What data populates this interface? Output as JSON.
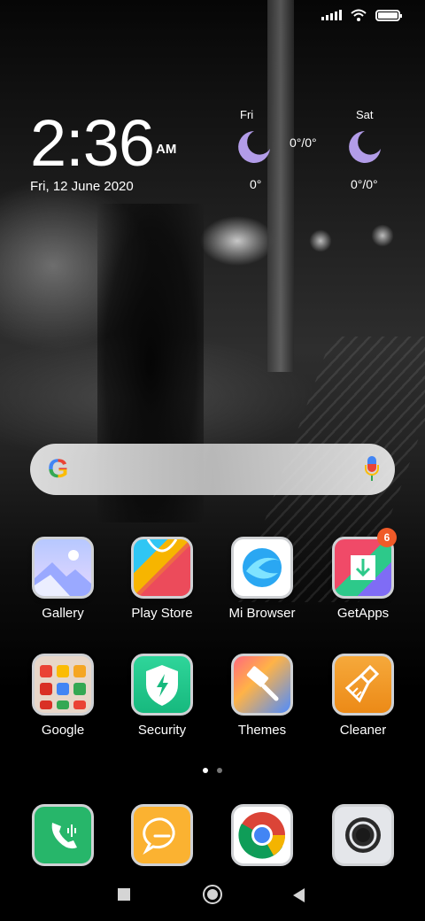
{
  "status_bar": {
    "signal_icon": "signal-icon",
    "wifi_icon": "wifi-icon",
    "battery_icon": "battery-icon",
    "battery_level": 1.0
  },
  "clock": {
    "time": "2:36",
    "ampm": "AM",
    "date": "Fri, 12 June 2020"
  },
  "weather": {
    "days": [
      {
        "day": "Fri",
        "icon": "moon-icon",
        "temp_low": "0°",
        "temp_range": "0°/0°"
      },
      {
        "day": "Sat",
        "icon": "moon-icon",
        "temp_range": "0°/0°"
      }
    ],
    "moon_color": "#b29ce8"
  },
  "search": {
    "logo": "G",
    "mic_icon": "mic-icon"
  },
  "apps": [
    {
      "label": "Gallery",
      "icon": "gallery-icon"
    },
    {
      "label": "Play Store",
      "icon": "play-store-icon"
    },
    {
      "label": "Mi Browser",
      "icon": "mi-browser-icon"
    },
    {
      "label": "GetApps",
      "icon": "getapps-icon",
      "badge": "6"
    },
    {
      "label": "Google",
      "icon": "google-folder-icon"
    },
    {
      "label": "Security",
      "icon": "security-icon"
    },
    {
      "label": "Themes",
      "icon": "themes-icon"
    },
    {
      "label": "Cleaner",
      "icon": "cleaner-icon"
    }
  ],
  "page_indicator": {
    "pages": 2,
    "current": 1
  },
  "dock": [
    {
      "icon": "phone-icon"
    },
    {
      "icon": "messages-icon"
    },
    {
      "icon": "chrome-icon"
    },
    {
      "icon": "camera-icon"
    }
  ],
  "nav": {
    "recents_icon": "recents-icon",
    "home_icon": "home-icon",
    "back_icon": "back-icon"
  },
  "colors": {
    "badge": "#f05a28",
    "icon_border": "#cfd1d4"
  }
}
